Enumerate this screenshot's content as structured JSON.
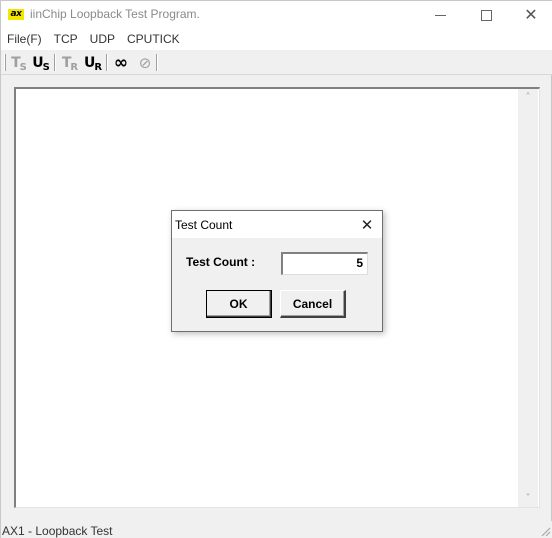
{
  "window": {
    "title": "iinChip Loopback Test Program.",
    "icon_label": "ax"
  },
  "menu": {
    "items": [
      "File(F)",
      "TCP",
      "UDP",
      "CPUTICK"
    ]
  },
  "toolbar": {
    "buttons": [
      {
        "name": "tcp-server-icon",
        "main": "T",
        "sub": "S",
        "enabled": false
      },
      {
        "name": "udp-server-icon",
        "main": "U",
        "sub": "S",
        "enabled": true
      },
      {
        "name": "tcp-recv-icon",
        "main": "T",
        "sub": "R",
        "enabled": false
      },
      {
        "name": "udp-recv-icon",
        "main": "U",
        "sub": "R",
        "enabled": true
      },
      {
        "name": "infinity-icon",
        "glyph": "∞",
        "enabled": true
      },
      {
        "name": "stop-icon",
        "glyph": "⊘",
        "enabled": false
      }
    ]
  },
  "dialog": {
    "title": "Test Count",
    "close_glyph": "✕",
    "label": "Test Count :",
    "value": "5",
    "ok_label": "OK",
    "cancel_label": "Cancel"
  },
  "status": {
    "text": "AX1 - Loopback Test"
  },
  "glyphs": {
    "close": "✕",
    "scroll_up": "˄",
    "scroll_down": "˅"
  }
}
